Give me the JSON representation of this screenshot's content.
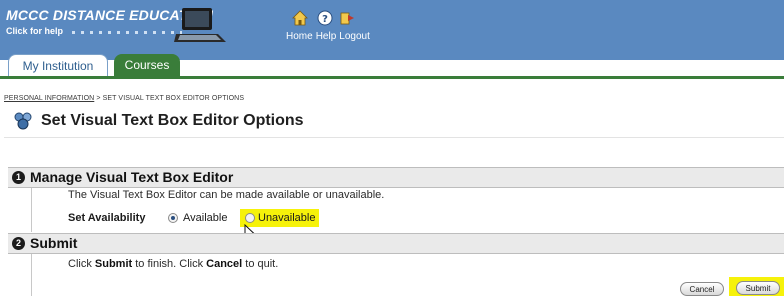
{
  "header": {
    "brand": "MCCC DISTANCE EDUCATION",
    "help_tagline": "Click for help",
    "nav": [
      "Home",
      "Help",
      "Logout"
    ]
  },
  "tabs": [
    {
      "label": "My Institution",
      "active": true
    },
    {
      "label": "Courses",
      "active": false
    }
  ],
  "breadcrumb": {
    "link": "PERSONAL INFORMATION",
    "separator": ">",
    "current": "SET VISUAL TEXT BOX EDITOR OPTIONS"
  },
  "page_title": "Set Visual Text Box Editor Options",
  "section1": {
    "number": "1",
    "heading": "Manage Visual Text Box Editor",
    "description": "The Visual Text Box Editor can be made available or unavailable.",
    "availability_label": "Set Availability",
    "options": [
      {
        "label": "Available",
        "selected": true
      },
      {
        "label": "Unavailable",
        "selected": false,
        "highlighted": true
      }
    ]
  },
  "section2": {
    "number": "2",
    "heading": "Submit",
    "text_parts": [
      "Click ",
      "Submit",
      " to finish. Click ",
      "Cancel",
      " to quit."
    ]
  },
  "buttons": {
    "cancel": "Cancel",
    "submit": "Submit"
  },
  "colors": {
    "header_bg": "#5a89c0",
    "tab_green": "#3a7d3a",
    "highlight": "#f6f20a"
  }
}
